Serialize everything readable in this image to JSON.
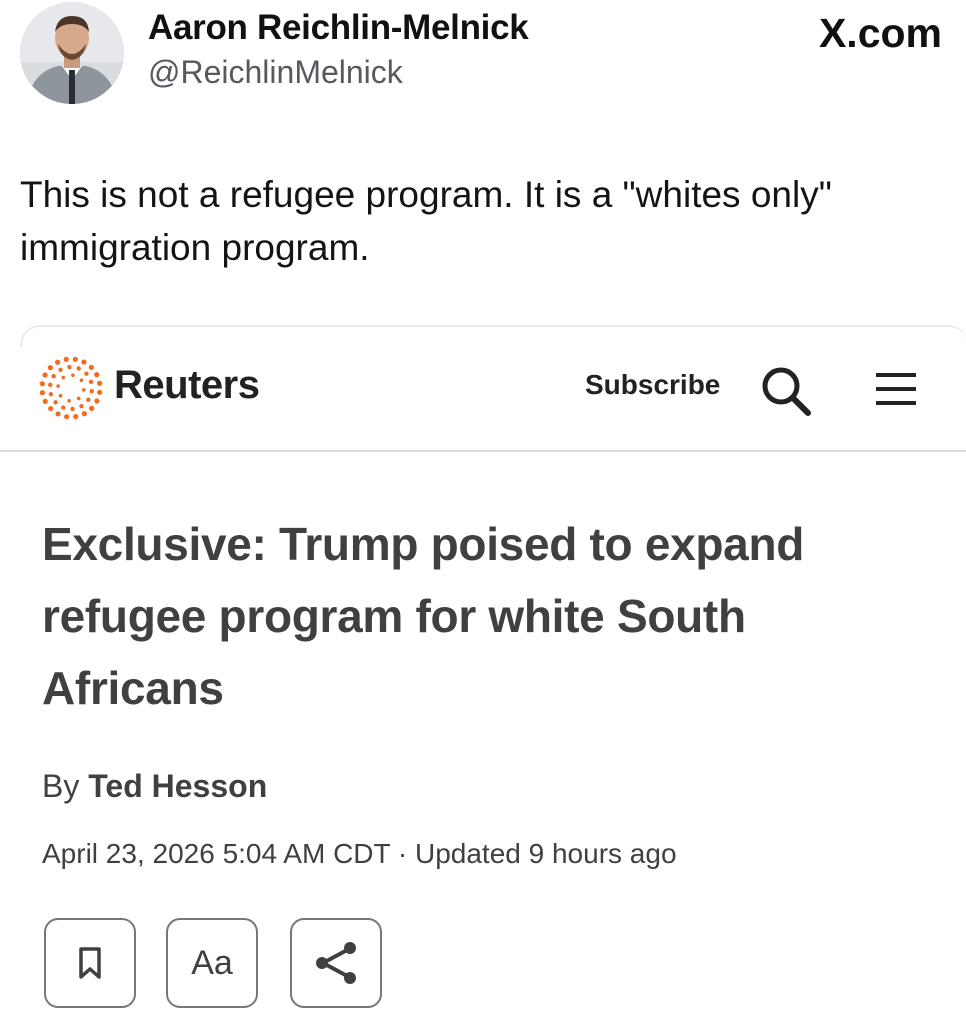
{
  "tweet": {
    "author_name": "Aaron Reichlin-Melnick",
    "author_handle": "@ReichlinMelnick",
    "site_label": "X.com",
    "text": "This is not a refugee program. It is a \"whites only\" immigration program."
  },
  "article": {
    "brand": "Reuters",
    "subscribe_label": "Subscribe",
    "search_icon": "search-icon",
    "menu_icon": "menu-icon",
    "headline": "Exclusive: Trump poised to expand refugee program for white South Africans",
    "byline_prefix": "By",
    "byline_author": "Ted Hesson",
    "dateline": "April 23, 2026 5:04 AM CDT · Updated 9 hours ago",
    "tools": {
      "bookmark_icon": "bookmark-icon",
      "text_size_label": "Aa",
      "share_icon": "share-icon"
    }
  },
  "colors": {
    "reuters_orange": "#f26b1f",
    "headline_gray": "#404040"
  }
}
